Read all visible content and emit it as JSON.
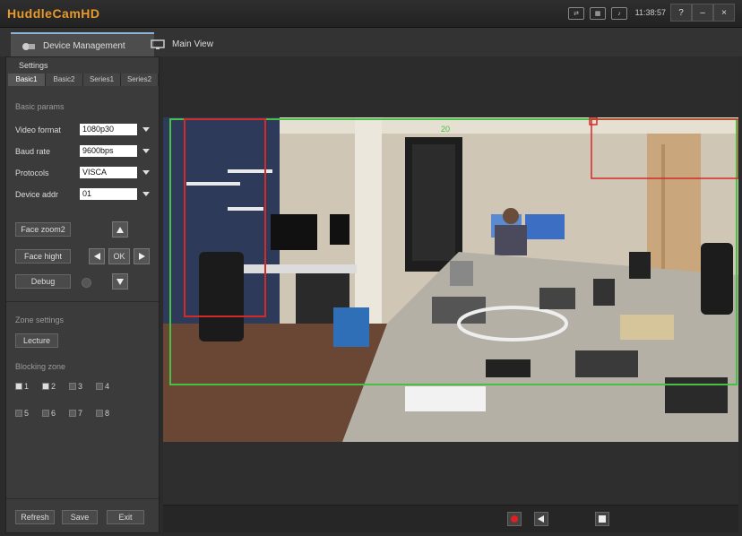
{
  "app": {
    "title": "HuddleCamHD",
    "tray_icons": [
      "network-icon",
      "cpu-icon",
      "sound-icon"
    ],
    "clock": "11:38:57",
    "buttons": {
      "help": "?",
      "minimize": "–",
      "close": "×"
    }
  },
  "tabs": [
    {
      "label": "Device Management",
      "icon": "camera-gear-icon",
      "active": true
    },
    {
      "label": "Main View",
      "icon": "monitor-icon",
      "active": false
    }
  ],
  "sidebar": {
    "settings_label": "Settings",
    "subtabs": [
      "Basic1",
      "Basic2",
      "Series1",
      "Series2"
    ],
    "basic_params_label": "Basic params",
    "fields": [
      {
        "label": "Video format",
        "value": "1080p30"
      },
      {
        "label": "Baud rate",
        "value": "9600bps"
      },
      {
        "label": "Protocols",
        "value": "VISCA"
      },
      {
        "label": "Device addr",
        "value": "01"
      }
    ],
    "controls": {
      "face_zoom": "Face zoom2",
      "face_high": "Face hight",
      "debug": "Debug",
      "ok": "OK"
    },
    "zone_settings_label": "Zone settings",
    "lecture_label": "Lecture",
    "blocking_zone_label": "Blocking zone",
    "zones": [
      {
        "label": "1",
        "on": true
      },
      {
        "label": "2",
        "on": true
      },
      {
        "label": "3",
        "on": false
      },
      {
        "label": "4",
        "on": false
      },
      {
        "label": "5",
        "on": false
      },
      {
        "label": "6",
        "on": false
      },
      {
        "label": "7",
        "on": false
      },
      {
        "label": "8",
        "on": false
      }
    ],
    "footer": {
      "refresh": "Refresh",
      "save": "Save",
      "exit": "Exit"
    }
  },
  "video": {
    "green_box_label": "20",
    "colors": {
      "green_zone": "#48c043",
      "red_zone": "#d32a2a"
    }
  },
  "bottombar": {
    "buttons": [
      "record-icon",
      "play-back-icon",
      "stop-icon"
    ],
    "record_color": "#e02020"
  }
}
